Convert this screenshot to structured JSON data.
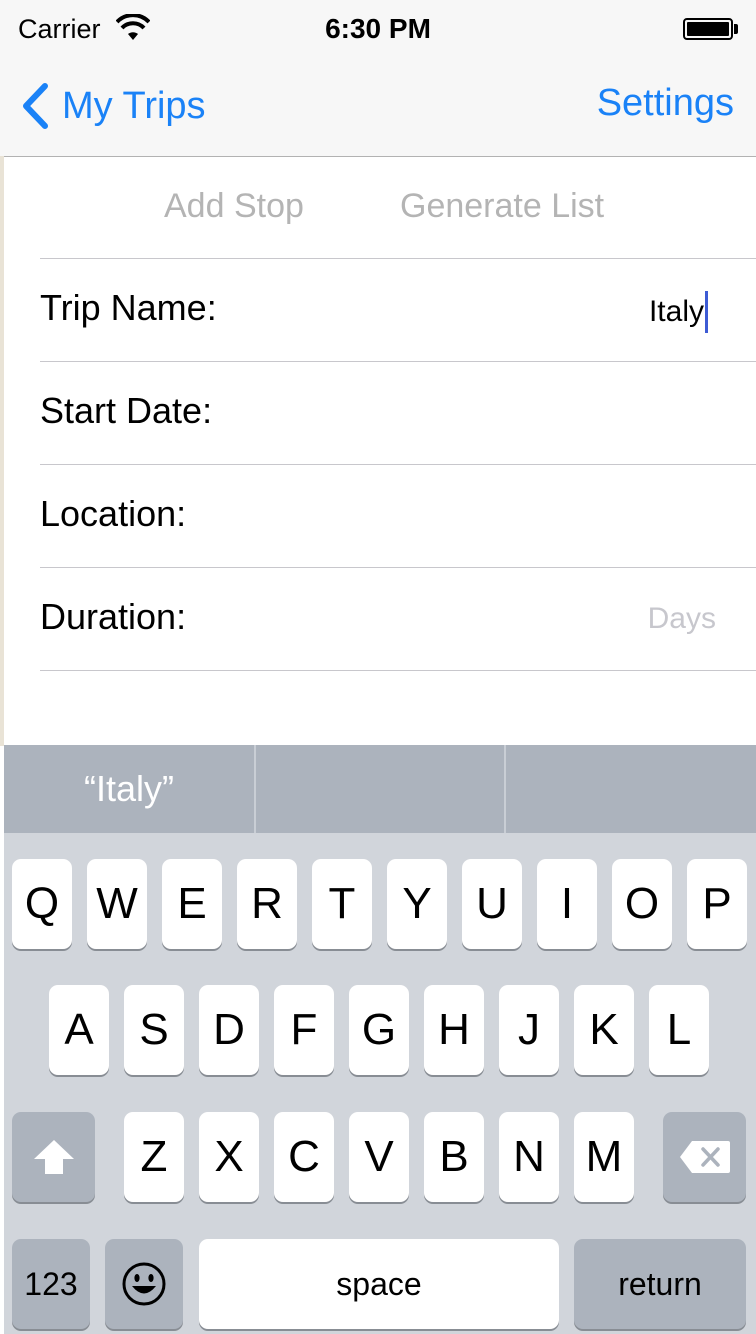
{
  "status_bar": {
    "carrier": "Carrier",
    "time": "6:30 PM"
  },
  "nav": {
    "back_label": "My Trips",
    "right_label": "Settings"
  },
  "toolbar": {
    "add_stop": "Add Stop",
    "generate_list": "Generate List"
  },
  "form": {
    "trip_name": {
      "label": "Trip Name:",
      "value": "Italy"
    },
    "start_date": {
      "label": "Start Date:"
    },
    "location": {
      "label": "Location:"
    },
    "duration": {
      "label": "Duration:",
      "placeholder": "Days"
    }
  },
  "keyboard": {
    "suggestions": [
      "“Italy”",
      "",
      ""
    ],
    "row1": [
      "Q",
      "W",
      "E",
      "R",
      "T",
      "Y",
      "U",
      "I",
      "O",
      "P"
    ],
    "row2": [
      "A",
      "S",
      "D",
      "F",
      "G",
      "H",
      "J",
      "K",
      "L"
    ],
    "row3": [
      "Z",
      "X",
      "C",
      "V",
      "B",
      "N",
      "M"
    ],
    "numbers_key": "123",
    "space_key": "space",
    "return_key": "return"
  },
  "colors": {
    "tint": "#1a82f7",
    "keyboard_bg": "#d1d5db",
    "suggestion_bar": "#acb3bd"
  },
  "icons": [
    "wifi-icon",
    "battery-icon",
    "chevron-left-icon",
    "shift-icon",
    "delete-icon",
    "emoji-icon"
  ]
}
